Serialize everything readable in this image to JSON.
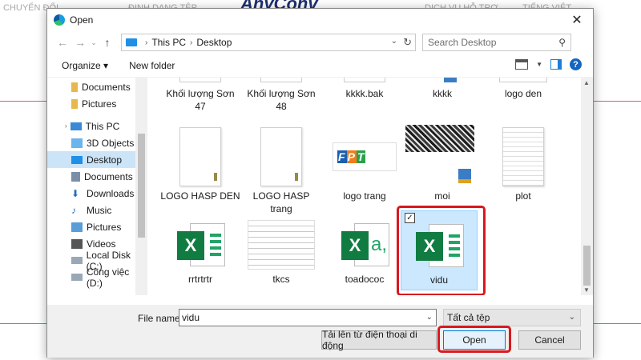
{
  "background_site": {
    "nav_items": [
      "CHUYỂN ĐỔI",
      "ĐỊNH DẠNG TỆP",
      "DỊCH VỤ HỖ TRỢ",
      "TIẾNG VIỆT"
    ],
    "logo_text": "AnyConv"
  },
  "dialog": {
    "title": "Open",
    "address": {
      "root": "This PC",
      "folder": "Desktop"
    },
    "search_placeholder": "Search Desktop",
    "toolbar": {
      "organize_label": "Organize ▾",
      "new_folder_label": "New folder"
    },
    "nav_items": [
      {
        "label": "Documents",
        "icon": "folder-icon"
      },
      {
        "label": "Pictures",
        "icon": "folder-icon"
      },
      {
        "label": "This PC",
        "icon": "computer-icon"
      },
      {
        "label": "3D Objects",
        "icon": "cube-icon"
      },
      {
        "label": "Desktop",
        "icon": "desktop-icon",
        "selected": true
      },
      {
        "label": "Documents",
        "icon": "documents-icon"
      },
      {
        "label": "Downloads",
        "icon": "download-icon"
      },
      {
        "label": "Music",
        "icon": "music-icon"
      },
      {
        "label": "Pictures",
        "icon": "pictures-icon"
      },
      {
        "label": "Videos",
        "icon": "videos-icon"
      },
      {
        "label": "Local Disk (C:)",
        "icon": "drive-icon"
      },
      {
        "label": "Công việc (D:)",
        "icon": "drive-icon"
      }
    ],
    "files": [
      {
        "name": "Khối lượng Sơn 47",
        "type": "partial"
      },
      {
        "name": "Khối lượng Sơn 48",
        "type": "partial"
      },
      {
        "name": "kkkk.bak",
        "type": "partial"
      },
      {
        "name": "kkkk",
        "type": "dwg"
      },
      {
        "name": "logo den",
        "type": "image"
      },
      {
        "name": "LOGO HASP DEN",
        "type": "document"
      },
      {
        "name": "LOGO HASP trang",
        "type": "document"
      },
      {
        "name": "logo trang",
        "type": "fpt-logo"
      },
      {
        "name": "moi",
        "type": "dwg-image"
      },
      {
        "name": "plot",
        "type": "text-document"
      },
      {
        "name": "rrtrtrtr",
        "type": "excel"
      },
      {
        "name": "tkcs",
        "type": "document-thumbnail"
      },
      {
        "name": "toadococ",
        "type": "csv"
      },
      {
        "name": "vidu",
        "type": "excel",
        "selected": true
      }
    ],
    "footer": {
      "file_name_label": "File name:",
      "file_name_value": "vidu",
      "filter_value": "Tất cả tệp",
      "upload_button": "Tải lên từ điện thoại di động",
      "open_button": "Open",
      "cancel_button": "Cancel"
    },
    "colors": {
      "highlight": "#d7191f",
      "excel_green": "#107c41",
      "selection": "#cce8ff"
    }
  }
}
